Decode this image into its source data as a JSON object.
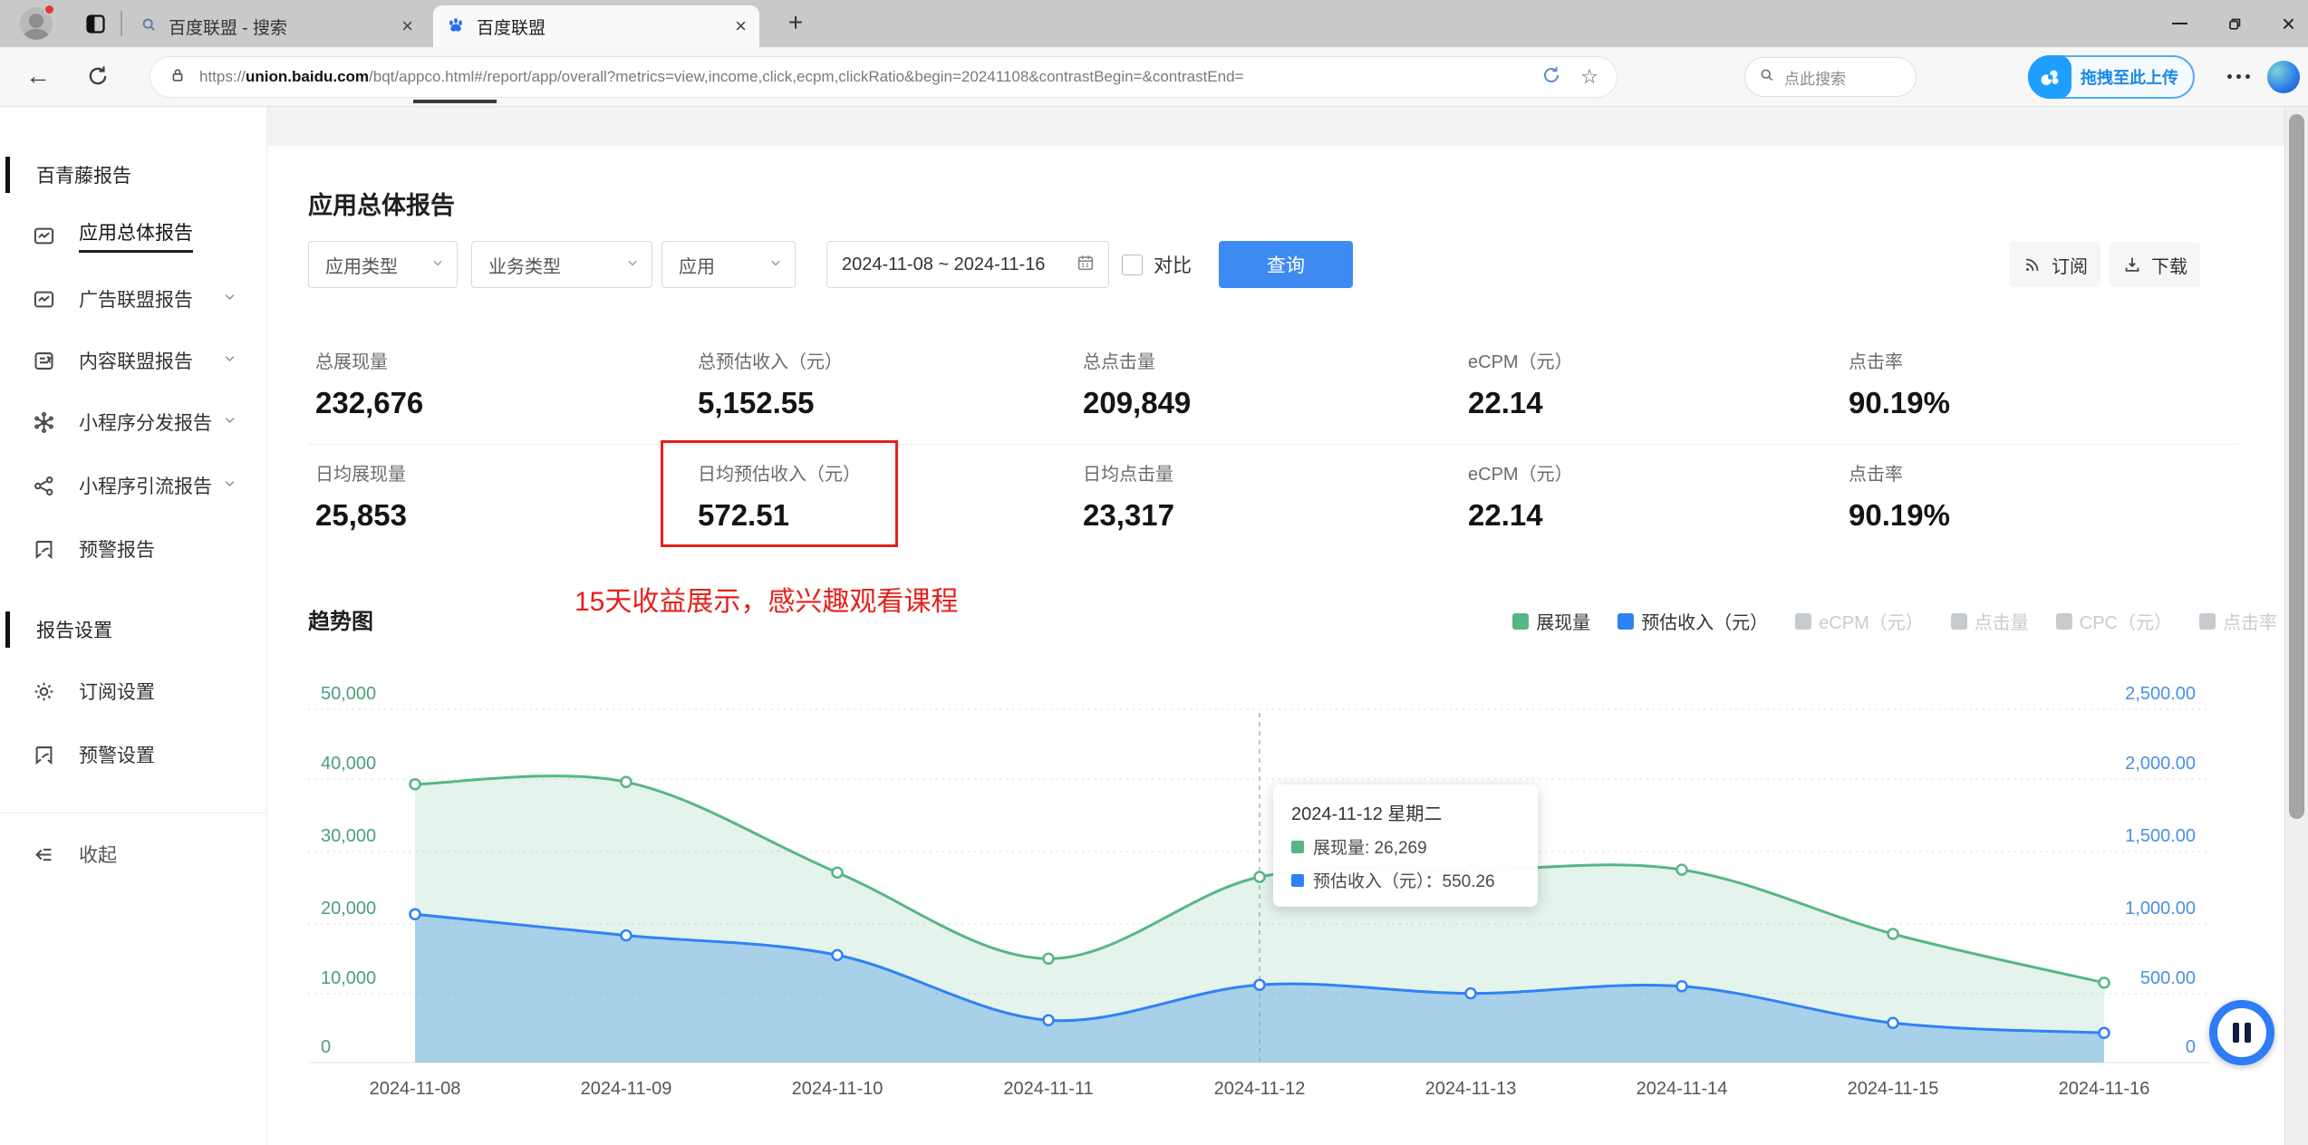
{
  "browser": {
    "tabs": [
      {
        "title": "百度联盟 - 搜索",
        "icon": "search-tab-icon",
        "active": false
      },
      {
        "title": "百度联盟",
        "icon": "baidu-paw-icon",
        "active": true
      }
    ],
    "url": {
      "prefix": "https://",
      "domain": "union.baidu.com",
      "path": "/bqt/appco.html#/report/app/overall?metrics=view,income,click,ecpm,clickRatio&begin=20241108&contrastBegin=&contrastEnd="
    },
    "search_placeholder": "点此搜索",
    "upload_label": "拖拽至此上传"
  },
  "sidebar": {
    "sections": [
      {
        "header": "百青藤报告",
        "items": [
          {
            "key": "overall-report",
            "label": "应用总体报告",
            "icon": "report-icon",
            "active": true
          },
          {
            "key": "ad-union-report",
            "label": "广告联盟报告",
            "icon": "report-icon",
            "chevron": true
          },
          {
            "key": "content-union-report",
            "label": "内容联盟报告",
            "icon": "content-icon",
            "chevron": true
          },
          {
            "key": "miniapp-distribution-report",
            "label": "小程序分发报告",
            "icon": "network-icon",
            "chevron": true
          },
          {
            "key": "miniapp-referral-report",
            "label": "小程序引流报告",
            "icon": "share-icon",
            "chevron": true
          },
          {
            "key": "alert-report",
            "label": "预警报告",
            "icon": "bookmark-icon"
          }
        ]
      },
      {
        "header": "报告设置",
        "items": [
          {
            "key": "subscribe-settings",
            "label": "订阅设置",
            "icon": "gear-icon"
          },
          {
            "key": "alert-settings",
            "label": "预警设置",
            "icon": "bookmark-icon"
          }
        ]
      }
    ],
    "collapse": {
      "label": "收起",
      "icon": "collapse-icon"
    }
  },
  "page": {
    "title": "应用总体报告",
    "filters": {
      "app_type": "应用类型",
      "biz_type": "业务类型",
      "app": "应用",
      "date_range": "2024-11-08 ~ 2024-11-16",
      "contrast_label": "对比",
      "query_button": "查询",
      "subscribe_button": "订阅",
      "download_button": "下载"
    },
    "stats_rows": [
      [
        {
          "label": "总展现量",
          "value": "232,676"
        },
        {
          "label": "总预估收入（元）",
          "value": "5,152.55"
        },
        {
          "label": "总点击量",
          "value": "209,849"
        },
        {
          "label": "eCPM（元）",
          "value": "22.14"
        },
        {
          "label": "点击率",
          "value": "90.19%"
        }
      ],
      [
        {
          "label": "日均展现量",
          "value": "25,853"
        },
        {
          "label": "日均预估收入（元）",
          "value": "572.51",
          "highlight": true
        },
        {
          "label": "日均点击量",
          "value": "23,317"
        },
        {
          "label": "eCPM（元）",
          "value": "22.14"
        },
        {
          "label": "点击率",
          "value": "90.19%"
        }
      ]
    ],
    "annotation": "15天收益展示，感兴趣观看课程"
  },
  "chart_data": {
    "type": "area",
    "title": "趋势图",
    "x": [
      "2024-11-08",
      "2024-11-09",
      "2024-11-10",
      "2024-11-11",
      "2024-11-12",
      "2024-11-13",
      "2024-11-14",
      "2024-11-15",
      "2024-11-16"
    ],
    "series": [
      {
        "name": "展现量",
        "axis": "left",
        "color": "#57b686",
        "fill": "rgba(87,182,134,0.16)",
        "values": [
          39400,
          39700,
          26900,
          14700,
          26269,
          27200,
          27300,
          18200,
          11300
        ]
      },
      {
        "name": "预估收入（元）",
        "axis": "right",
        "color": "#2f82f6",
        "fill": "rgba(108,173,230,0.50)",
        "values": [
          1050,
          900,
          760,
          300,
          550.26,
          490,
          540,
          280,
          210
        ]
      }
    ],
    "y_left": {
      "max": 50000,
      "labels": [
        "50,000",
        "40,000",
        "30,000",
        "20,000",
        "10,000",
        "0"
      ],
      "color": "#4c9f7b"
    },
    "y_right": {
      "max": 2500,
      "labels": [
        "2,500.00",
        "2,000.00",
        "1,500.00",
        "1,000.00",
        "500.00",
        "0"
      ],
      "color": "#4a90e2"
    },
    "legend": [
      {
        "label": "展现量",
        "color": "#57b686",
        "active": true
      },
      {
        "label": "预估收入（元）",
        "color": "#2f82f6",
        "active": true
      },
      {
        "label": "eCPM（元）",
        "color": "#c7cbd0",
        "active": false
      },
      {
        "label": "点击量",
        "color": "#c7cbd0",
        "active": false
      },
      {
        "label": "CPC（元）",
        "color": "#c7cbd0",
        "active": false
      },
      {
        "label": "点击率",
        "color": "#c7cbd0",
        "active": false
      }
    ],
    "legend_position": "top-right",
    "grid": true,
    "tooltip": {
      "title": "2024-11-12 星期二",
      "index": 4,
      "rows": [
        {
          "color": "#57b686",
          "text": "展现量: 26,269"
        },
        {
          "color": "#2f82f6",
          "text": "预估收入（元）：550.26"
        }
      ]
    }
  }
}
